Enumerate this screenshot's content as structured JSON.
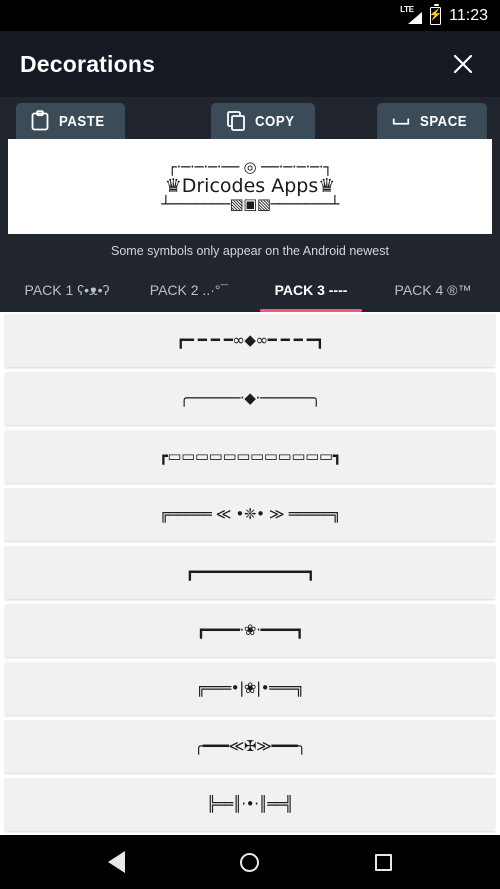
{
  "statusbar": {
    "network_label": "LTE",
    "battery_icon": "battery-charging-icon",
    "clock": "11:23"
  },
  "header": {
    "title": "Decorations",
    "close_icon": "close-icon",
    "background": "#151a22"
  },
  "actions": [
    {
      "label": "PASTE",
      "icon": "clipboard-icon"
    },
    {
      "label": "COPY",
      "icon": "copy-icon"
    },
    {
      "label": "SPACE",
      "icon": "spacebar-icon"
    }
  ],
  "preview": {
    "line_top": "┌·─·─·─·── ◎ ──·─·─·─·┐",
    "line_mid": "♛Dricodes Apps♛",
    "line_bottom": "┴───────▧▣▧───────┴",
    "background": "#ffffff",
    "text_color": "#1a1a1a"
  },
  "hint": {
    "text": "Some symbols only appear on the Android newest"
  },
  "packtabs": {
    "active_index": 2,
    "accent_color": "#f8567f",
    "items": [
      {
        "label": "PACK 1 ʕ•ᴥ•ʔ"
      },
      {
        "label": "PACK 2 ..·°¯"
      },
      {
        "label": "PACK 3 ----"
      },
      {
        "label": "PACK 4 ®™"
      }
    ]
  },
  "list": {
    "background": "#ffffff",
    "card_background": "#f1f1f1",
    "items": [
      {
        "text": "┏━ ━ ━ ━∞◆∞━ ━ ━ ━┓"
      },
      {
        "text": "╭──────·◆·──────╮"
      },
      {
        "text": "┏▭▭▭▭▭▭▭▭▭▭▭▭┓"
      },
      {
        "text": "╔═════ ≪ •❈• ≫ ═════╗"
      },
      {
        "text": "┏━━━━━━━━━━━━━┓"
      },
      {
        "text": "┏━━━━·❀·━━━━┓"
      },
      {
        "text": "╔═══•|❀|•═══╗"
      },
      {
        "text": "╭━━━≪✠≫━━━╮"
      },
      {
        "text": "╠══║·•·║══╣"
      }
    ]
  },
  "navbar": {
    "back_icon": "back-triangle-icon",
    "home_icon": "home-circle-icon",
    "recents_icon": "recents-square-icon"
  }
}
